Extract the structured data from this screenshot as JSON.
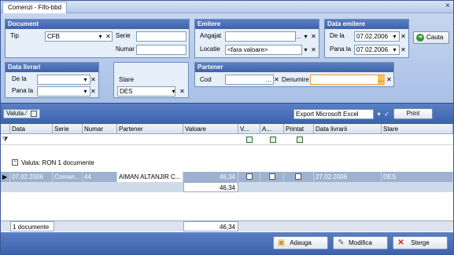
{
  "window": {
    "tab_title": "Comenzi - Fifo-bbd",
    "close": "×"
  },
  "document": {
    "header": "Document",
    "tip_label": "Tip",
    "tip_value": "CFB",
    "serie_label": "Serie",
    "serie_value": "",
    "numar_label": "Numar",
    "numar_value": ""
  },
  "emitere": {
    "header": "Emitere",
    "angajat_label": "Angajat",
    "angajat_value": "",
    "locatie_label": "Locatie",
    "locatie_value": "<fara valoare>"
  },
  "data_emitere": {
    "header": "Data emitere",
    "dela_label": "De la",
    "dela_value": "07.02.2006",
    "panala_label": "Pana la",
    "panala_value": "07.02.2006"
  },
  "cauta_label": "Cauta",
  "data_livrare": {
    "header": "Data livrari",
    "dela_label": "De la",
    "dela_value": "",
    "panala_label": "Pana la",
    "panala_value": ""
  },
  "stare": {
    "label": "Stare",
    "value": "DES"
  },
  "partener": {
    "header": "Partener",
    "cod_label": "Cod",
    "cod_value": "",
    "denumire_label": "Denumire",
    "denumire_value": ""
  },
  "grouping": {
    "chip_label": "Valuta ⁄"
  },
  "export": {
    "value": "Export Microsoft Excel",
    "print_label": "Print"
  },
  "grid": {
    "columns": [
      "Data",
      "Serie",
      "Numar",
      "Partener",
      "Valoare",
      "V...",
      "A...",
      "Printat",
      "Data livrarii",
      "Stare"
    ],
    "group_label": "Valuta: RON 1 documente",
    "row": {
      "data": "07.02.2006",
      "serie": "Coman...",
      "numar": "44",
      "partener": "AIMAN ALTANJIR C...",
      "valoare": "46,34",
      "data_livrarii": "27.02.2006",
      "stare": "DES"
    },
    "group_sum": "46,34",
    "footer_count": "1 documente",
    "footer_sum": "46,34"
  },
  "buttons": {
    "adauga": "Adauga",
    "modifica": "Modifica",
    "sterge": "Sterge"
  },
  "colors": {
    "accent": "#3e62a8",
    "row_selected": "#9eb1d0"
  }
}
